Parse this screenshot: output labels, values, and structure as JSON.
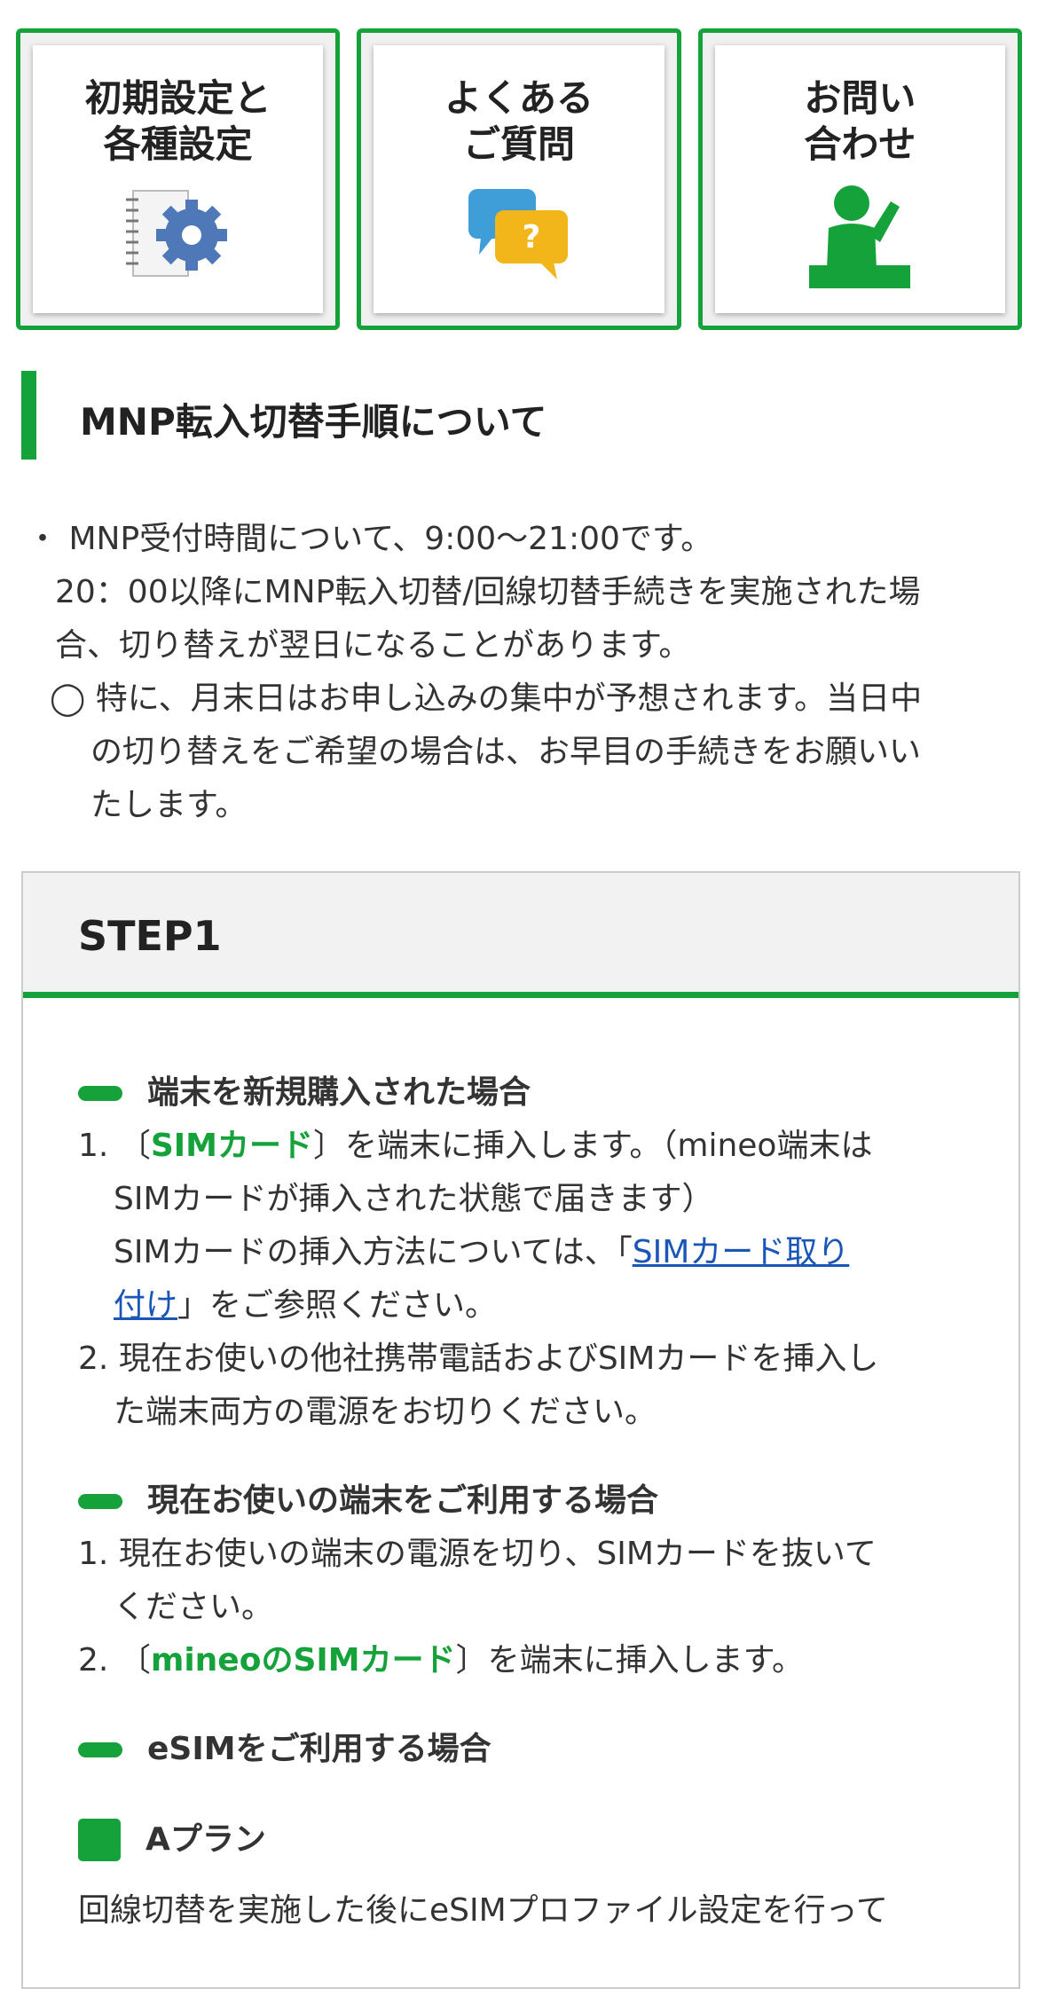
{
  "tiles": [
    {
      "label": "初期設定と\n各種設定",
      "icon": "settings-notebook-icon"
    },
    {
      "label": "よくある\nご質問",
      "icon": "faq-speech-bubbles-icon"
    },
    {
      "label": "お問い\n合わせ",
      "icon": "support-person-icon"
    }
  ],
  "section_title": "MNP転入切替手順について",
  "notes": {
    "bullet": "・",
    "line1": "MNP受付時間について、9:00〜21:00です。",
    "line2": "20：00以降にMNP転入切替/回線切替手続きを実施された場",
    "line3": "合、切り替えが翌日になることがあります。",
    "circle": "◯",
    "line4": "特に、月末日はお申し込みの集中が予想されます。当日中",
    "line5": "の切り替えをご希望の場合は、お早目の手続きをお願いい",
    "line6": "たします。"
  },
  "step": {
    "title": "STEP1",
    "new_device": {
      "heading": "端末を新規購入された場合",
      "i1_num": "1.",
      "i1_pre": "〔",
      "i1_green": "SIMカード",
      "i1_post": "〕を端末に挿入します。（mineo端末は",
      "i1_l2": "SIMカードが挿入された状態で届きます）",
      "i1_l3": "SIMカードの挿入方法については、「",
      "i1_link1": "SIMカード取り",
      "i1_link2": "付け",
      "i1_l4": "」をご参照ください。",
      "i2_num": "2.",
      "i2_l1": "現在お使いの他社携帯電話およびSIMカードを挿入し",
      "i2_l2": "た端末両方の電源をお切りください。"
    },
    "current_device": {
      "heading": "現在お使いの端末をご利用する場合",
      "i1_num": "1.",
      "i1_l1": "現在お使いの端末の電源を切り、SIMカードを抜いて",
      "i1_l2": "ください。",
      "i2_num": "2.",
      "i2_pre": "〔",
      "i2_green": "mineoのSIMカード",
      "i2_post": "〕を端末に挿入します。"
    },
    "esim": {
      "heading": "eSIMをご利用する場合",
      "plan": "Aプラン",
      "text": "回線切替を実施した後にeSIMプロファイル設定を行って"
    }
  },
  "colors": {
    "accent": "#16a23a",
    "link": "#1a55b8"
  }
}
